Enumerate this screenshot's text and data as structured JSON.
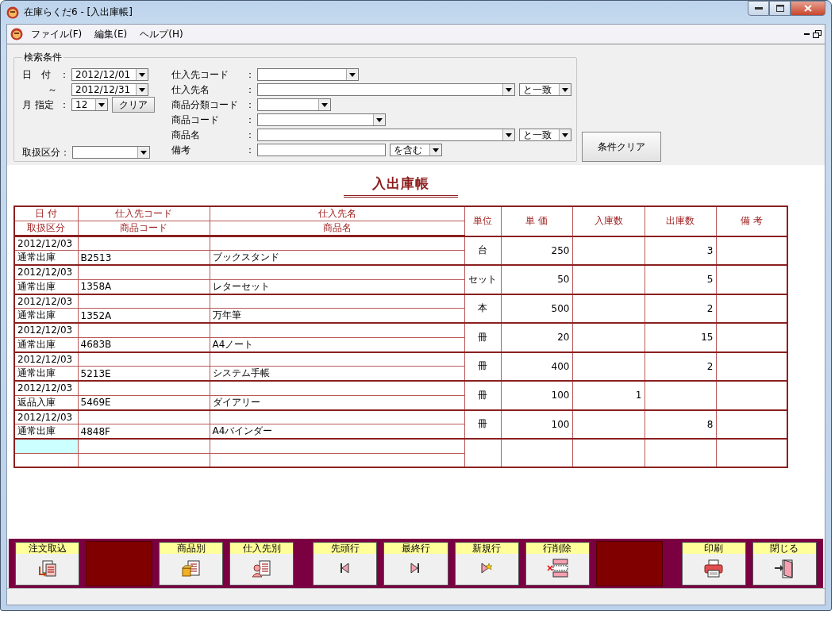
{
  "window": {
    "title": "在庫らくだ6 - [入出庫帳]"
  },
  "menu": [
    {
      "label": "ファイル(F)"
    },
    {
      "label": "編集(E)"
    },
    {
      "label": "ヘルプ(H)"
    }
  ],
  "search": {
    "legend": "検索条件",
    "left": [
      {
        "label": "日　付",
        "colon": "：",
        "value": "2012/12/01"
      },
      {
        "label": "～",
        "value": "2012/12/31"
      },
      {
        "label": "月 指定",
        "colon": "：",
        "value": "12",
        "button": "クリア"
      },
      {
        "label": "取扱区分："
      }
    ],
    "right": [
      {
        "label": "仕入先コード",
        "colon": "：",
        "kind": "combo"
      },
      {
        "label": "仕入先名",
        "colon": "：",
        "kind": "combo",
        "match": "と一致"
      },
      {
        "label": "商品分類コード",
        "colon": "：",
        "kind": "combo"
      },
      {
        "label": "商品コード",
        "colon": "：",
        "kind": "combo"
      },
      {
        "label": "商品名",
        "colon": "：",
        "kind": "combo",
        "match": "と一致"
      },
      {
        "label": "備考",
        "colon": "：",
        "kind": "text",
        "match": "を含む"
      }
    ],
    "clear_button": "条件クリア"
  },
  "report": {
    "title": "入出庫帳",
    "header_top": [
      "日 付",
      "仕入先コード",
      "仕入先名"
    ],
    "header_bottom": [
      "取扱区分",
      "商品コード",
      "商品名"
    ],
    "header_span": [
      "単位",
      "単 価",
      "入庫数",
      "出庫数",
      "備 考"
    ],
    "rows": [
      {
        "date": "2012/12/03",
        "type": "通常出庫",
        "product_code": "B2513",
        "product_name": "ブックスタンド",
        "unit": "台",
        "price": "250",
        "in": "",
        "out": "3",
        "note": ""
      },
      {
        "date": "2012/12/03",
        "type": "通常出庫",
        "product_code": "1358A",
        "product_name": "レターセット",
        "unit": "セット",
        "price": "50",
        "in": "",
        "out": "5",
        "note": ""
      },
      {
        "date": "2012/12/03",
        "type": "通常出庫",
        "product_code": "1352A",
        "product_name": "万年筆",
        "unit": "本",
        "price": "500",
        "in": "",
        "out": "2",
        "note": ""
      },
      {
        "date": "2012/12/03",
        "type": "通常出庫",
        "product_code": "4683B",
        "product_name": "A4ノート",
        "unit": "冊",
        "price": "20",
        "in": "",
        "out": "15",
        "note": ""
      },
      {
        "date": "2012/12/03",
        "type": "通常出庫",
        "product_code": "5213E",
        "product_name": "システム手帳",
        "unit": "冊",
        "price": "400",
        "in": "",
        "out": "2",
        "note": ""
      },
      {
        "date": "2012/12/03",
        "type": "返品入庫",
        "product_code": "5469E",
        "product_name": "ダイアリー",
        "unit": "冊",
        "price": "100",
        "in": "1",
        "out": "",
        "note": ""
      },
      {
        "date": "2012/12/03",
        "type": "通常出庫",
        "product_code": "4848F",
        "product_name": "A4バインダー",
        "unit": "冊",
        "price": "100",
        "in": "",
        "out": "8",
        "note": ""
      }
    ],
    "new_row": {
      "selected": true
    }
  },
  "toolbar": [
    {
      "kind": "button",
      "label": "注文取込"
    },
    {
      "kind": "blank"
    },
    {
      "kind": "button",
      "label": "商品別"
    },
    {
      "kind": "button",
      "label": "仕入先別"
    },
    {
      "kind": "gap"
    },
    {
      "kind": "button",
      "label": "先頭行"
    },
    {
      "kind": "button",
      "label": "最終行"
    },
    {
      "kind": "button",
      "label": "新規行"
    },
    {
      "kind": "button",
      "label": "行削除"
    },
    {
      "kind": "blank"
    },
    {
      "kind": "gap"
    },
    {
      "kind": "button",
      "label": "印刷"
    },
    {
      "kind": "button",
      "label": "閉じる"
    }
  ]
}
